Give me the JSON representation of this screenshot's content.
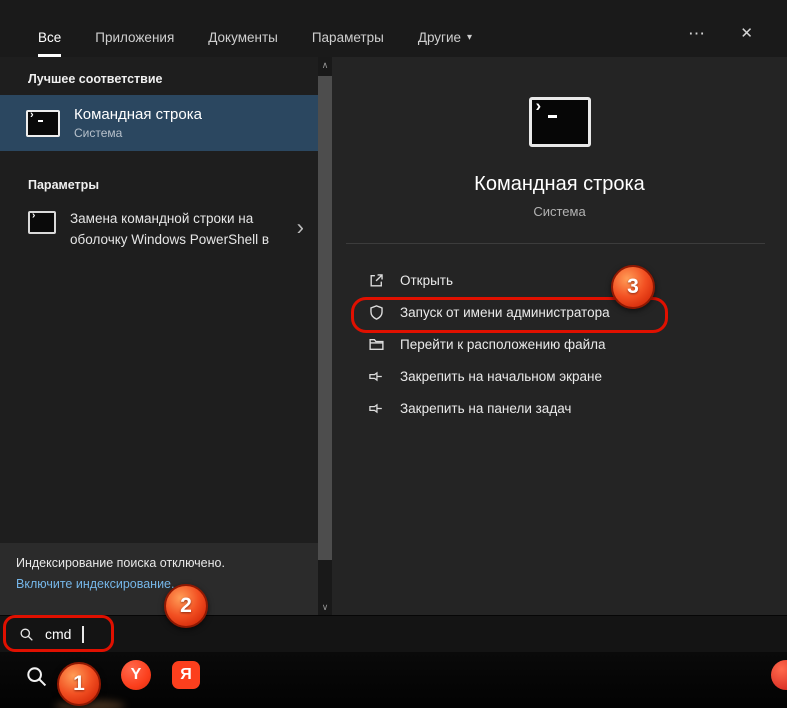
{
  "tabs": {
    "items": [
      {
        "label": "Все",
        "active": true
      },
      {
        "label": "Приложения",
        "active": false
      },
      {
        "label": "Документы",
        "active": false
      },
      {
        "label": "Параметры",
        "active": false
      },
      {
        "label": "Другие",
        "active": false,
        "has_dropdown": true
      }
    ]
  },
  "icons": {
    "dropdown": "▾",
    "ellipsis": "⋯",
    "close": "✕",
    "chevron_right": "›",
    "scroll_up": "∧",
    "scroll_down": "∨"
  },
  "left_panel": {
    "best_match_header": "Лучшее соответствие",
    "best_match": {
      "title": "Командная строка",
      "subtitle": "Система"
    },
    "settings_header": "Параметры",
    "settings_item": {
      "line1": "Замена командной строки на",
      "line2": "оболочку Windows PowerShell в"
    },
    "status": {
      "message": "Индексирование поиска отключено.",
      "link": "Включите индексирование."
    }
  },
  "preview": {
    "title": "Командная строка",
    "subtitle": "Система",
    "actions": [
      {
        "label": "Открыть",
        "icon": "open-icon"
      },
      {
        "label": "Запуск от имени администратора",
        "icon": "admin-shield-icon"
      },
      {
        "label": "Перейти к расположению файла",
        "icon": "folder-location-icon"
      },
      {
        "label": "Закрепить на начальном экране",
        "icon": "pin-icon"
      },
      {
        "label": "Закрепить на панели задач",
        "icon": "pin-icon"
      }
    ]
  },
  "search": {
    "value": "cmd"
  },
  "taskbar": {
    "browser_letter": "Y",
    "yandex_app_letter": "Я"
  },
  "annotations": {
    "step1": "1",
    "step2": "2",
    "step3": "3"
  },
  "colors": {
    "best_match_highlight": "#2b4760",
    "annotation_orange": "#f25022",
    "outline_red": "#e01000",
    "link_blue": "#75b6e8"
  }
}
